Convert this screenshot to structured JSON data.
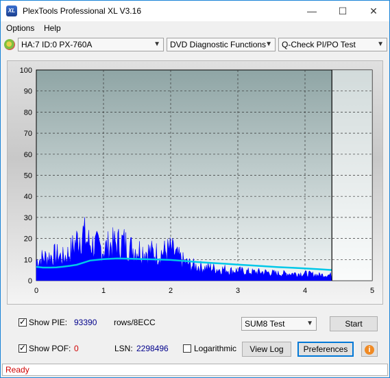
{
  "window": {
    "title": "PlexTools Professional XL V3.16",
    "app_icon_text": "XL"
  },
  "menu": {
    "options": "Options",
    "help": "Help"
  },
  "toolbar": {
    "drive": "HA:7 ID:0  PX-760A",
    "function": "DVD Diagnostic Functions",
    "test": "Q-Check PI/PO Test"
  },
  "chart_data": {
    "type": "area",
    "x_ticks": [
      "0",
      "1",
      "2",
      "3",
      "4",
      "5"
    ],
    "y_ticks": [
      "100",
      "90",
      "80",
      "70",
      "60",
      "50",
      "40",
      "30",
      "20",
      "10",
      "0"
    ],
    "xlim": [
      0,
      5
    ],
    "ylim": [
      0,
      100
    ],
    "grid": true,
    "test_end_x": 4.4,
    "series": [
      {
        "color": "#0000ff",
        "x": [
          0,
          0.1,
          0.2,
          0.3,
          0.4,
          0.5,
          0.55,
          0.6,
          0.65,
          0.7,
          0.75,
          0.8,
          0.9,
          1.0,
          1.1,
          1.2,
          1.3,
          1.4,
          1.5,
          1.6,
          1.7,
          1.8,
          1.9,
          2.0,
          2.1,
          2.2,
          2.3,
          2.4,
          2.5,
          2.6,
          2.7,
          2.8,
          2.9,
          3.0,
          3.2,
          3.4,
          3.6,
          3.8,
          4.0,
          4.2,
          4.4
        ],
        "y": [
          14,
          16,
          17,
          18,
          16,
          20,
          24,
          28,
          32,
          33,
          28,
          26,
          24,
          22,
          25,
          26,
          27,
          23,
          22,
          21,
          20,
          19,
          20,
          22,
          17,
          13,
          11,
          10,
          9,
          9,
          8,
          8,
          7,
          7,
          6,
          6,
          5,
          5,
          5,
          4,
          4
        ]
      },
      {
        "color": "#00c8e8",
        "x": [
          0,
          0.1,
          0.2,
          0.3,
          0.4,
          0.5,
          0.6,
          0.7,
          0.8,
          1.0,
          1.2,
          1.4,
          1.6,
          1.8,
          2.0,
          2.2,
          2.4,
          2.6,
          2.8,
          3.0,
          3.2,
          3.4,
          3.6,
          3.8,
          4.0,
          4.2,
          4.4
        ],
        "y": [
          6.5,
          6.2,
          6.2,
          6.3,
          6.6,
          7,
          7.5,
          8.5,
          9.5,
          10.2,
          10.5,
          10.4,
          10.2,
          10,
          9.8,
          9.3,
          8.8,
          8.4,
          8,
          7.6,
          7.2,
          6.8,
          6.4,
          6.1,
          5.8,
          5.4,
          5
        ]
      }
    ]
  },
  "controls": {
    "show_pie_label": "Show PIE:",
    "pie_value": "93390",
    "pie_unit": "rows/8ECC",
    "show_pof_label": "Show POF:",
    "pof_value": "0",
    "lsn_label": "LSN:",
    "lsn_value": "2298496",
    "logarithmic_label": "Logarithmic",
    "sum_select": "SUM8 Test",
    "start_button": "Start",
    "view_log_button": "View Log",
    "preferences_button": "Preferences"
  },
  "status": {
    "text": "Ready"
  }
}
